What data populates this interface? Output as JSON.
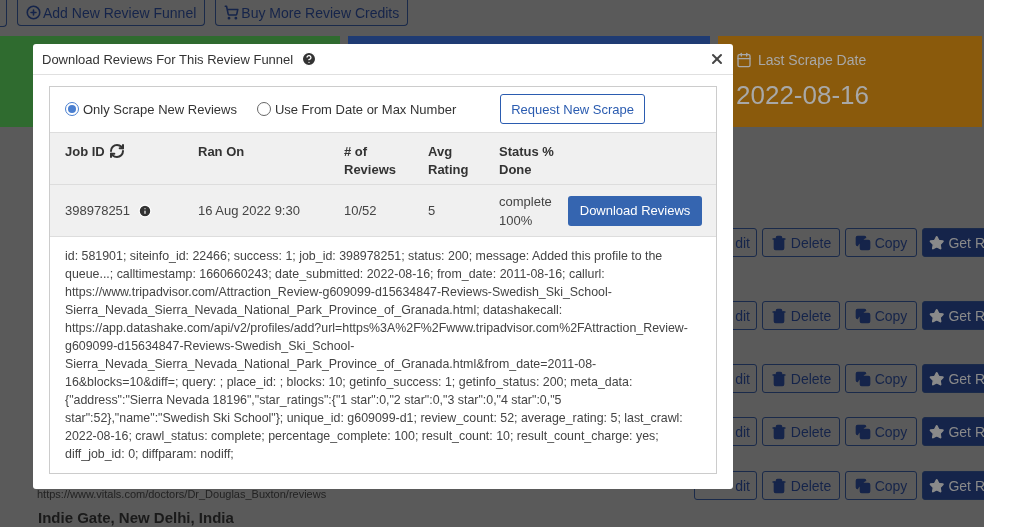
{
  "toolbar": {
    "buttons": [
      "Add New Review Funnel",
      "Buy More Review Credits"
    ]
  },
  "stat_cards": [
    {
      "color": "#2f6b2f"
    },
    {
      "color": "#1f3b73"
    },
    {
      "color": "#8a5a0c",
      "label": "Last Scrape Date",
      "value": "2022-08-16"
    }
  ],
  "funnel_rows": [
    {
      "actions": [
        "dit",
        "Delete",
        "Copy",
        "Get R"
      ]
    },
    {
      "actions": [
        "dit",
        "Delete",
        "Copy",
        "Get R"
      ]
    },
    {
      "actions": [
        "dit",
        "Delete",
        "Copy",
        "Get R"
      ]
    },
    {
      "actions": [
        "dit",
        "Delete",
        "Copy",
        "Get R"
      ]
    },
    {
      "actions": [
        "dit",
        "Delete",
        "Copy",
        "Get R"
      ],
      "url": "https://www.vitals.com/doctors/Dr_Douglas_Buxton/reviews"
    }
  ],
  "next_funnel": "Indie Gate, New Delhi, India",
  "modal": {
    "title": "Download Reviews For This Review Funnel",
    "radios": [
      {
        "label": "Only Scrape New Reviews",
        "selected": true
      },
      {
        "label": "Use From Date or Max Number",
        "selected": false
      }
    ],
    "request_button": "Request New Scrape",
    "table": {
      "columns": [
        "Job ID",
        "Ran On",
        "# of Reviews",
        "Avg Rating",
        "Status % Done"
      ],
      "rows": [
        {
          "job_id": "398978251",
          "ran_on": "16 Aug 2022 9:30",
          "reviews": "10/52",
          "avg_rating": "5",
          "status": "complete",
          "percent": "100%",
          "button": "Download Reviews"
        }
      ]
    },
    "details": "id: 581901; siteinfo_id: 22466; success: 1; job_id: 398978251; status: 200; message: Added this profile to the queue...; calltimestamp: 1660660243; date_submitted: 2022-08-16; from_date: 2011-08-16; callurl: https://www.tripadvisor.com/Attraction_Review-g609099-d15634847-Reviews-Swedish_Ski_School-Sierra_Nevada_Sierra_Nevada_National_Park_Province_of_Granada.html; datashakecall: https://app.datashake.com/api/v2/profiles/add?url=https%3A%2F%2Fwww.tripadvisor.com%2FAttraction_Review-g609099-d15634847-Reviews-Swedish_Ski_School-Sierra_Nevada_Sierra_Nevada_National_Park_Province_of_Granada.html&from_date=2011-08-16&blocks=10&diff=; query: ; place_id: ; blocks: 10; getinfo_success: 1; getinfo_status: 200; meta_data: {\"address\":\"Sierra Nevada 18196\",\"star_ratings\":{\"1 star\":0,\"2 star\":0,\"3 star\":0,\"4 star\":0,\"5 star\":52},\"name\":\"Swedish Ski School\"}; unique_id: g609099-d1; review_count: 52; average_rating: 5; last_crawl: 2022-08-16; crawl_status: complete; percentage_complete: 100; result_count: 10; result_count_charge: yes; diff_job_id: 0; diffparam: nodiff;"
  }
}
